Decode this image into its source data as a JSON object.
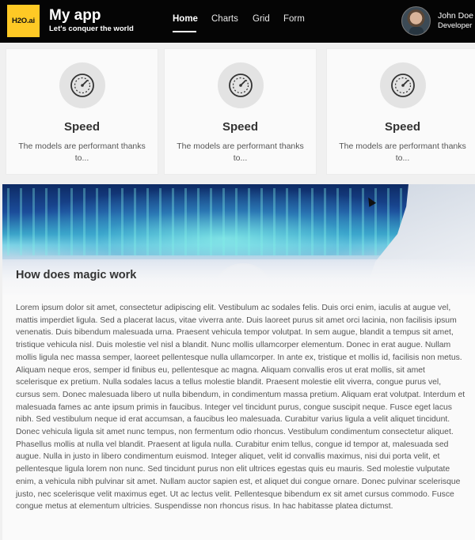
{
  "header": {
    "logo_text": "H2O.ai",
    "title": "My app",
    "subtitle": "Let's conquer the world",
    "nav": [
      {
        "label": "Home",
        "active": true
      },
      {
        "label": "Charts",
        "active": false
      },
      {
        "label": "Grid",
        "active": false
      },
      {
        "label": "Form",
        "active": false
      }
    ],
    "user": {
      "name": "John Doe",
      "role": "Developer"
    }
  },
  "cards": [
    {
      "icon": "speedometer-icon",
      "title": "Speed",
      "description": "The models are performant thanks to..."
    },
    {
      "icon": "speedometer-icon",
      "title": "Speed",
      "description": "The models are performant thanks to..."
    },
    {
      "icon": "speedometer-icon",
      "title": "Speed",
      "description": "The models are performant thanks to..."
    }
  ],
  "article": {
    "title": "How does magic work",
    "body": "Lorem ipsum dolor sit amet, consectetur adipiscing elit. Vestibulum ac sodales felis. Duis orci enim, iaculis at augue vel, mattis imperdiet ligula. Sed a placerat lacus, vitae viverra ante. Duis laoreet purus sit amet orci lacinia, non facilisis ipsum venenatis. Duis bibendum malesuada urna. Praesent vehicula tempor volutpat. In sem augue, blandit a tempus sit amet, tristique vehicula nisl. Duis molestie vel nisl a blandit. Nunc mollis ullamcorper elementum. Donec in erat augue. Nullam mollis ligula nec massa semper, laoreet pellentesque nulla ullamcorper. In ante ex, tristique et mollis id, facilisis non metus. Aliquam neque eros, semper id finibus eu, pellentesque ac magna. Aliquam convallis eros ut erat mollis, sit amet scelerisque ex pretium. Nulla sodales lacus a tellus molestie blandit. Praesent molestie elit viverra, congue purus vel, cursus sem. Donec malesuada libero ut nulla bibendum, in condimentum massa pretium. Aliquam erat volutpat. Interdum et malesuada fames ac ante ipsum primis in faucibus. Integer vel tincidunt purus, congue suscipit neque. Fusce eget lacus nibh. Sed vestibulum neque id erat accumsan, a faucibus leo malesuada. Curabitur varius ligula a velit aliquet tincidunt. Donec vehicula ligula sit amet nunc tempus, non fermentum odio rhoncus. Vestibulum condimentum consectetur aliquet. Phasellus mollis at nulla vel blandit. Praesent at ligula nulla. Curabitur enim tellus, congue id tempor at, malesuada sed augue. Nulla in justo in libero condimentum euismod. Integer aliquet, velit id convallis maximus, nisi dui porta velit, et pellentesque ligula lorem non nunc. Sed tincidunt purus non elit ultrices egestas quis eu mauris. Sed molestie vulputate enim, a vehicula nibh pulvinar sit amet. Nullam auctor sapien est, et aliquet dui congue ornare. Donec pulvinar scelerisque justo, nec scelerisque velit maximus eget. Ut ac lectus velit. Pellentesque bibendum ex sit amet cursus commodo. Fusce congue metus at elementum ultricies. Suspendisse non rhoncus risus. In hac habitasse platea dictumst."
  },
  "colors": {
    "header_bg": "#050505",
    "logo_bg": "#fec925",
    "card_icon_bg": "#e3e3e3"
  }
}
